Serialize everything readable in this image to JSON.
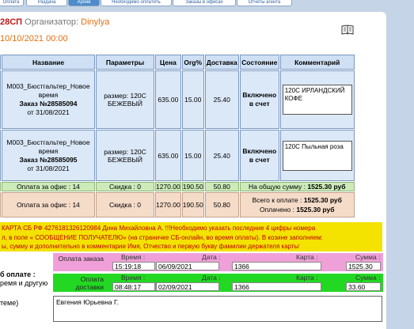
{
  "tabs": [
    "Оплата",
    "Раздача",
    "Архив",
    "Необходимо оплатить",
    "Заказы в офисах",
    "Отчеты агента"
  ],
  "header": {
    "number": "28СП",
    "organizer_label": "Организатор:",
    "organizer": "Dinylya",
    "date": "10/10/2021 00:00"
  },
  "columns": [
    "Название",
    "Параметры",
    "Цена",
    "Org%",
    "Доставка",
    "Состояние",
    "Комментарий"
  ],
  "orders": [
    {
      "name": "M003_Бюстгальтер_Новое время",
      "order": "Заказ №28585094",
      "date": "от 31/08/2021",
      "params": "размер: 120С БЕЖЕВЫЙ",
      "price": "635.00",
      "org": "15.00",
      "delivery": "25.40",
      "status": "Включено в счет",
      "comment": "120С ИРЛАНДСКИЙ КОФЕ"
    },
    {
      "name": "M003_Бюстгальтер_Новое время",
      "order": "Заказ №28585095",
      "date": "от 31/08/2021",
      "params": "размер: 120С БЕЖЕВЫЙ",
      "price": "635.00",
      "org": "15.00",
      "delivery": "25.40",
      "status": "Включено в счет",
      "comment": "120С Пыльная роза"
    }
  ],
  "summary1": {
    "office": "Оплата за офис : 14",
    "discount": "Скидка : 0",
    "price": "1270.00",
    "org": "190.50",
    "delivery": "50.80",
    "total_label": "На общую сумму :",
    "total": "1525.30 руб"
  },
  "summary2": {
    "office": "Оплата за офис : 14",
    "discount": "Скидка : 0",
    "price": "1270.00",
    "org": "190.50",
    "delivery": "50.80",
    "topay_label": "Всего к оплате :",
    "topay": "1525.30 руб",
    "paid_label": "Оплачено :",
    "paid": "1525.30 руб"
  },
  "notice": {
    "line1": "КАРТА СБ РФ 4276181326120984 Дина Михайловна А. !!!Необходимо указать последние 4 цифры номера",
    "line2": "л, в поле « СООБЩЕНИЕ ПОЛУЧАТЕЛЮ» (на страничке СБ-онлайн, во время оплаты). В козине заполняем:",
    "line3": "ы, сумму и дополнительно в комментарии Имя, Отчество и первую букву фамилии держателя картьг"
  },
  "payments": {
    "left_label_1": "б оплате :",
    "left_label_2": "ремя и другую",
    "left_label_3": "теме)",
    "field_labels": {
      "time": "Время :",
      "date": "Дата :",
      "card": "Карта :",
      "sum": "Сумма :"
    },
    "order_payment": {
      "title": "Оплата заказа",
      "time": "15:19:18",
      "date": "06/09/2021",
      "card": "1366",
      "sum": "1525.30"
    },
    "delivery_payment": {
      "title": "Оплата доставки",
      "time": "08:48:17",
      "date": "02/09/2021",
      "card": "1366",
      "sum": "33.60"
    },
    "payer_name": "Евгения Юрьевна Г."
  },
  "colors": {
    "panel_bg": "#c5d4e6",
    "header_cell": "#cfe0f5",
    "cell": "#dbe8f7",
    "green_row": "#ccebb9",
    "peach_row": "#f5dcc9",
    "notice": "#f4e200",
    "pink": "#f0a0d8",
    "green": "#22d822"
  }
}
